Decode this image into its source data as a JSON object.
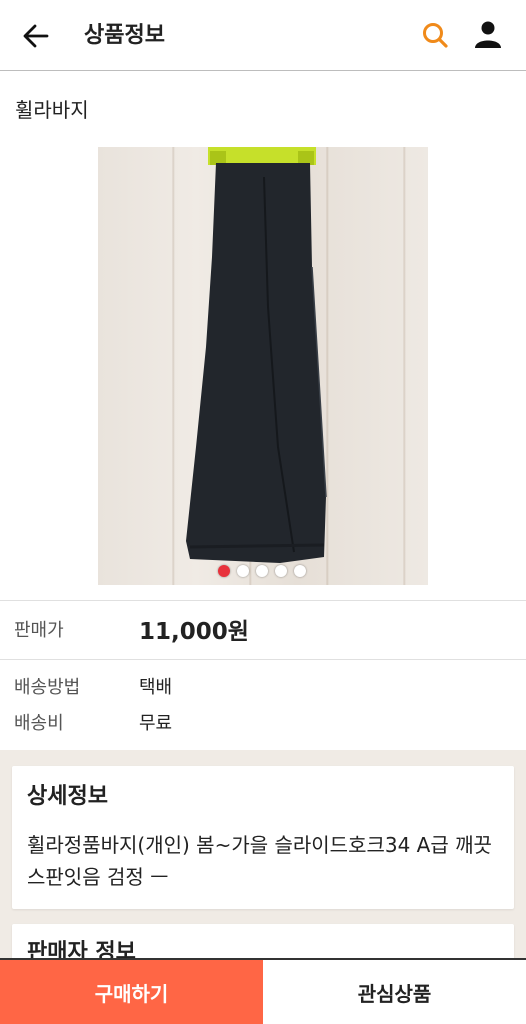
{
  "header": {
    "title": "상품정보",
    "icons": {
      "back": "back-arrow-icon",
      "search": "search-icon",
      "user": "user-icon"
    },
    "accent_color": "#f08a1a"
  },
  "product": {
    "name": "휠라바지",
    "image_alt": "black trousers hanging on yellow hanger",
    "image_count": 5,
    "active_image_index": 0
  },
  "price": {
    "label": "판매가",
    "value": "11,000원"
  },
  "shipping": {
    "method_label": "배송방법",
    "method_value": "택배",
    "fee_label": "배송비",
    "fee_value": "무료"
  },
  "detail": {
    "title": "상세정보",
    "text": "휠라정품바지(개인) 봄~가을 슬라이드호크34 A급 깨끗 스판잇음 검정 ㅡ"
  },
  "seller": {
    "title": "판매자 정보"
  },
  "bottom_bar": {
    "buy_label": "구매하기",
    "wish_label": "관심상품",
    "buy_color": "#ff6645"
  }
}
